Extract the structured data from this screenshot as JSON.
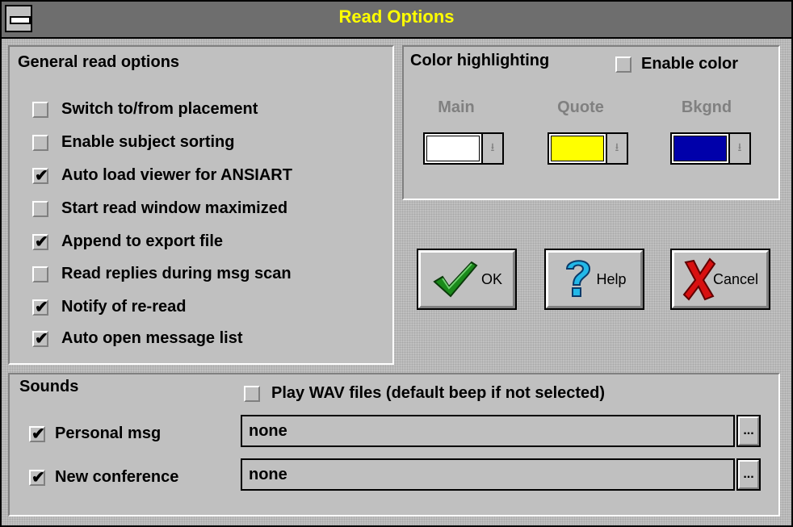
{
  "window": {
    "title": "Read Options"
  },
  "general": {
    "label": "General read options",
    "options": [
      {
        "label": "Switch to/from placement",
        "checked": false
      },
      {
        "label": "Enable subject sorting",
        "checked": false
      },
      {
        "label": "Auto load viewer for ANSIART",
        "checked": true
      },
      {
        "label": "Start read window maximized",
        "checked": false
      },
      {
        "label": "Append to export file",
        "checked": true
      },
      {
        "label": "Read replies during msg scan",
        "checked": false
      },
      {
        "label": "Notify of re-read",
        "checked": true
      },
      {
        "label": "Auto open message list",
        "checked": true
      }
    ]
  },
  "color": {
    "label": "Color highlighting",
    "enable_label": "Enable color",
    "enable_checked": false,
    "main_label": "Main",
    "quote_label": "Quote",
    "bkgnd_label": "Bkgnd",
    "main_color": "#ffffff",
    "quote_color": "#ffff00",
    "bkgnd_color": "#0000aa",
    "dropdown_icon": "down-arrow-icon"
  },
  "buttons": {
    "ok": "OK",
    "help": "Help",
    "cancel": "Cancel"
  },
  "sounds": {
    "label": "Sounds",
    "play_wav_label": "Play WAV files (default beep if not selected)",
    "play_wav_checked": false,
    "personal_label": "Personal msg",
    "personal_checked": true,
    "personal_value": "none",
    "conference_label": "New conference",
    "conference_checked": true,
    "conference_value": "none",
    "browse_label": "..."
  }
}
